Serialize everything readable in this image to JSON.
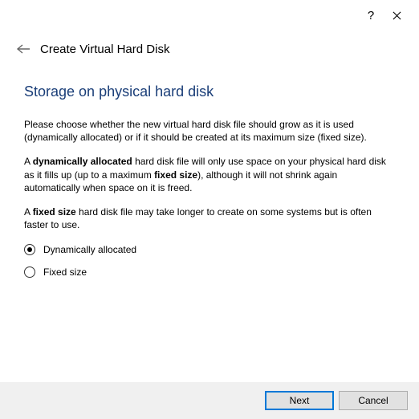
{
  "titlebar": {
    "help_symbol": "?",
    "close_symbol": "✕"
  },
  "header": {
    "title": "Create Virtual Hard Disk"
  },
  "section": {
    "title": "Storage on physical hard disk"
  },
  "paras": {
    "p1": "Please choose whether the new virtual hard disk file should grow as it is used (dynamically allocated) or if it should be created at its maximum size (fixed size).",
    "p2_a": "A ",
    "p2_b": "dynamically allocated",
    "p2_c": " hard disk file will only use space on your physical hard disk as it fills up (up to a maximum ",
    "p2_d": "fixed size",
    "p2_e": "), although it will not shrink again automatically when space on it is freed.",
    "p3_a": "A ",
    "p3_b": "fixed size",
    "p3_c": " hard disk file may take longer to create on some systems but is often faster to use."
  },
  "radios": {
    "dynamic": {
      "label": "Dynamically allocated",
      "selected": true
    },
    "fixed": {
      "label": "Fixed size",
      "selected": false
    }
  },
  "footer": {
    "next": "Next",
    "cancel": "Cancel"
  }
}
